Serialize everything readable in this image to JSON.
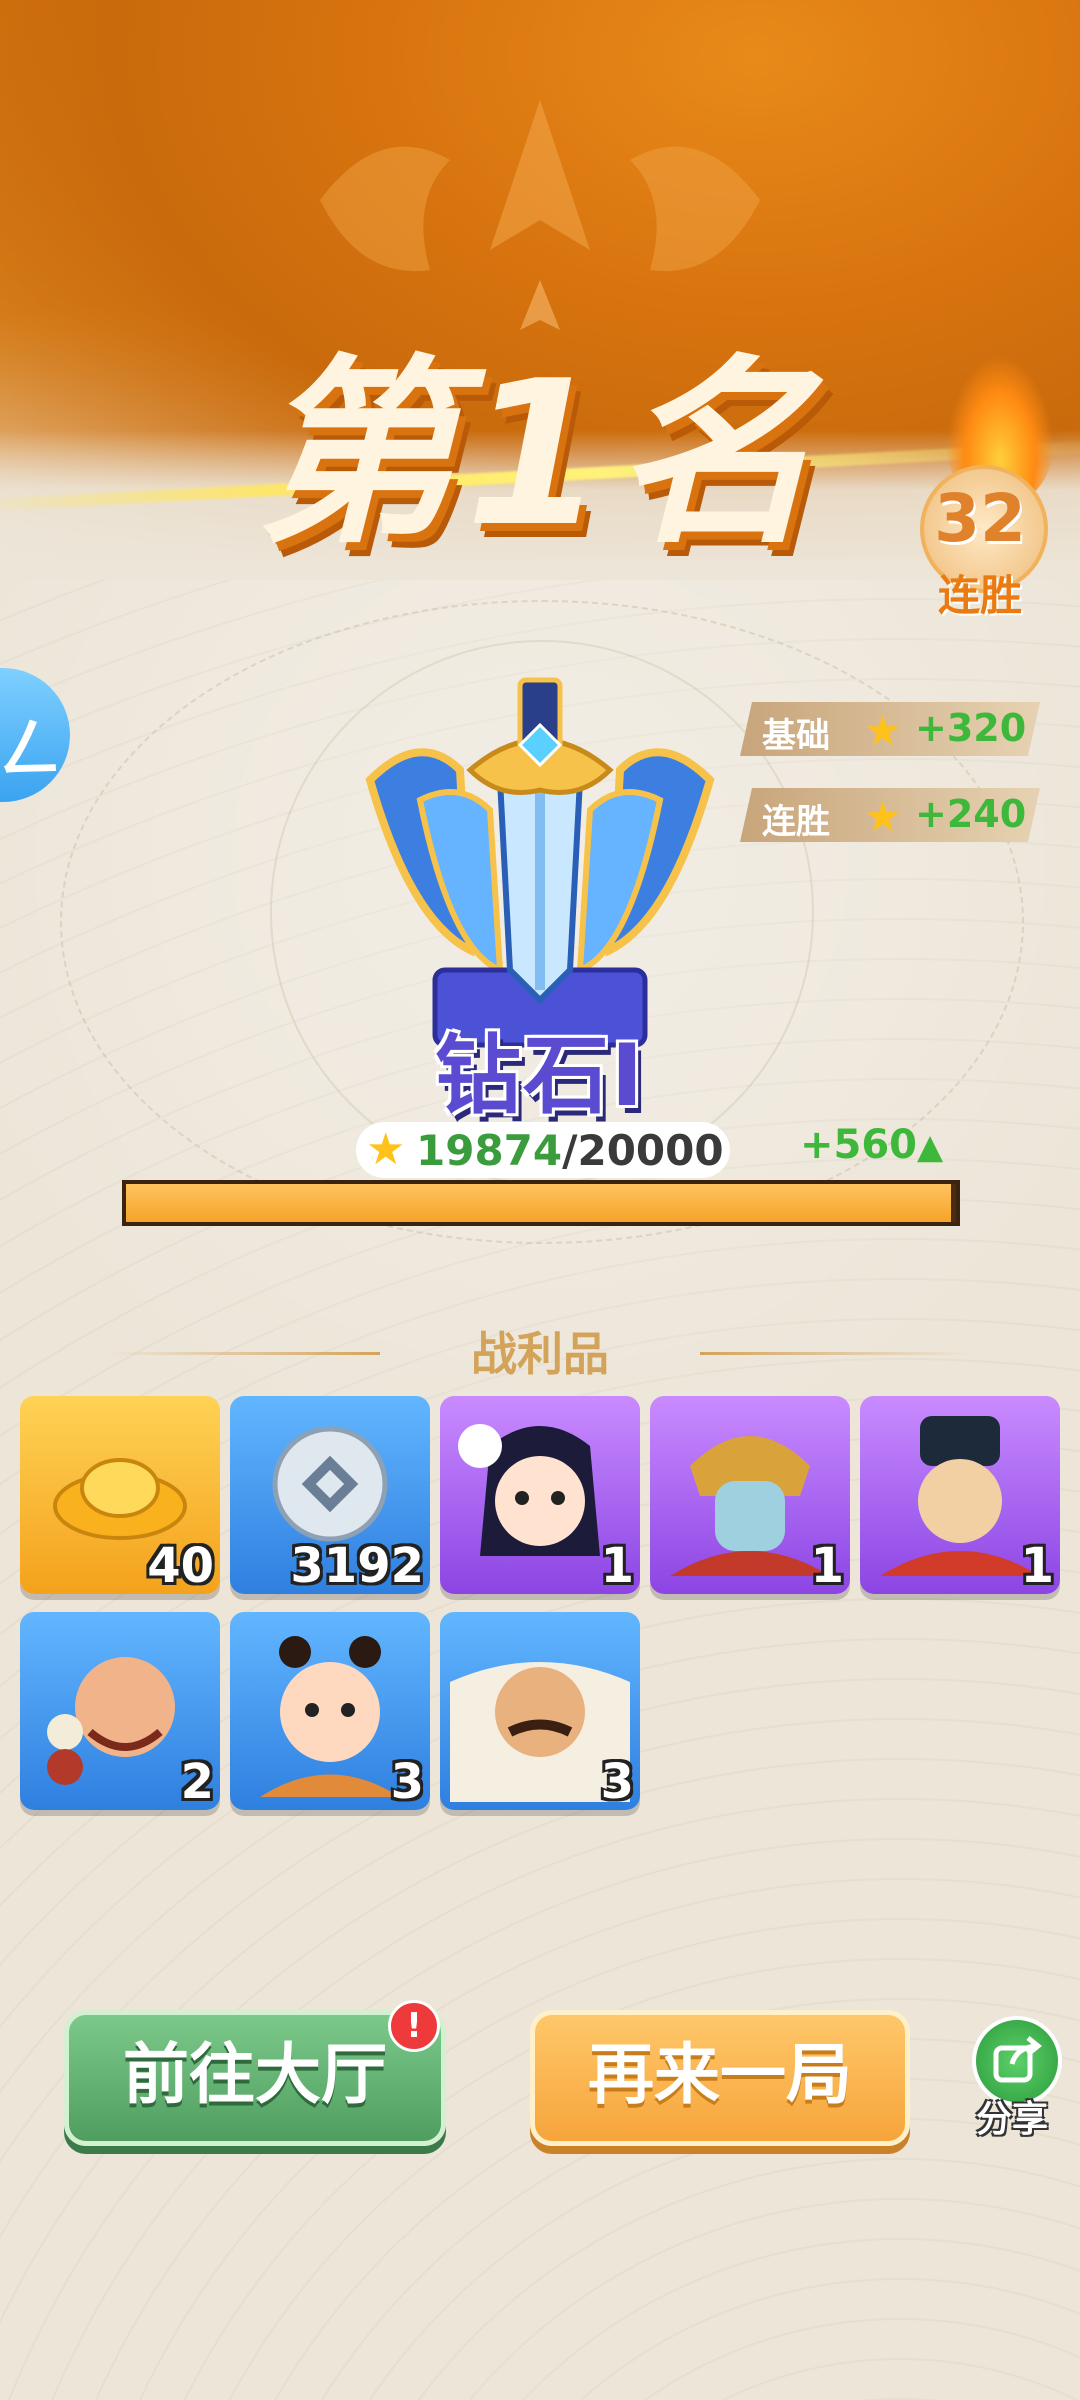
{
  "result": {
    "title": "第1名",
    "win_streak_count": "32",
    "win_streak_label": "连胜"
  },
  "bonuses": [
    {
      "label": "基础",
      "value": "+320"
    },
    {
      "label": "连胜",
      "value": "+240"
    }
  ],
  "rank": {
    "name": "钻石Ⅰ",
    "score_current": "19874",
    "score_total": "20000",
    "score_gain": "+560",
    "progress_fraction": 0.9937
  },
  "loot": {
    "title": "战利品",
    "items": [
      {
        "type": "gold-ingot",
        "count": "40"
      },
      {
        "type": "silver-coin",
        "count": "3192"
      },
      {
        "type": "hero-card-girl",
        "count": "1"
      },
      {
        "type": "hero-card-general",
        "count": "1"
      },
      {
        "type": "hero-card-official",
        "count": "1"
      },
      {
        "type": "hero-card-monk",
        "count": "2"
      },
      {
        "type": "hero-card-child",
        "count": "3"
      },
      {
        "type": "hero-card-warrior",
        "count": "3"
      }
    ]
  },
  "actions": {
    "lobby_label": "前往大厅",
    "again_label": "再来一局",
    "share_label": "分享",
    "alert_mark": "!"
  },
  "colors": {
    "accent_orange": "#f6a53b",
    "accent_green": "#4f9e60",
    "gain_green": "#3db83a",
    "rank_purple": "#5a4bd0"
  }
}
